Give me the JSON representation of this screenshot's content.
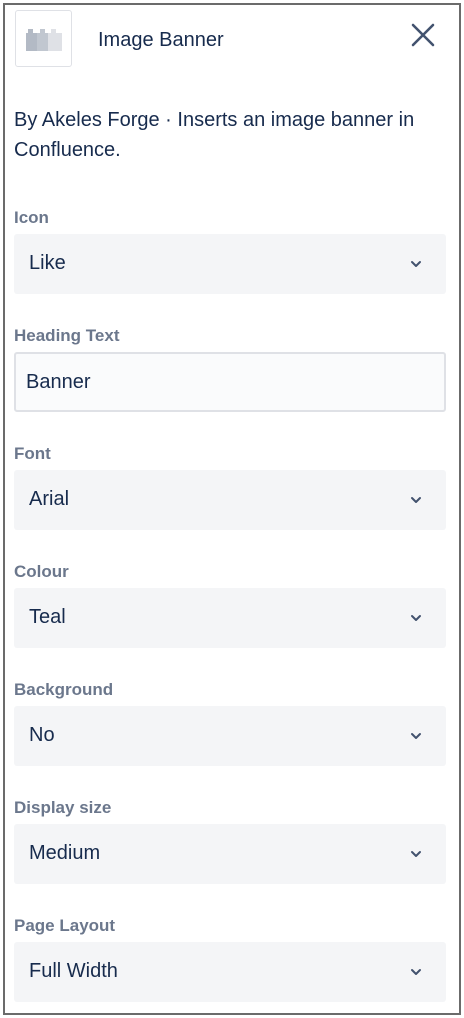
{
  "header": {
    "title": "Image Banner",
    "macro_icon": "macro-blocks-icon",
    "close_icon": "close-icon"
  },
  "description": "By Akeles Forge · Inserts an image banner in Confluence.",
  "fields": {
    "icon": {
      "label": "Icon",
      "value": "Like"
    },
    "heading_text": {
      "label": "Heading Text",
      "value": "Banner"
    },
    "font": {
      "label": "Font",
      "value": "Arial"
    },
    "colour": {
      "label": "Colour",
      "value": "Teal"
    },
    "background": {
      "label": "Background",
      "value": "No"
    },
    "display_size": {
      "label": "Display size",
      "value": "Medium"
    },
    "page_layout": {
      "label": "Page Layout",
      "value": "Full Width"
    }
  },
  "colors": {
    "text": "#172b4d",
    "label": "#6b778c",
    "select_bg": "#f4f5f7",
    "frame_border": "#6b6b6b"
  }
}
